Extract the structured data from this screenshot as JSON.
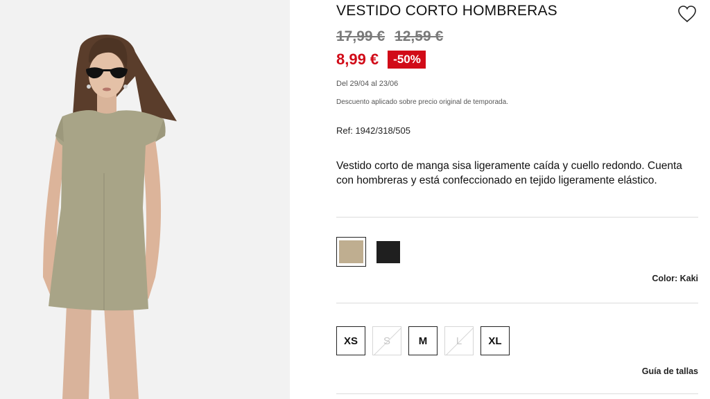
{
  "product": {
    "title": "VESTIDO CORTO HOMBRERAS",
    "old_prices": [
      "17,99 €",
      "12,59 €"
    ],
    "price": "8,99 €",
    "discount_badge": "-50%",
    "date_range": "Del 29/04 al 23/06",
    "discount_note": "Descuento aplicado sobre precio original de temporada.",
    "ref": "Ref: 1942/318/505",
    "description": "Vestido corto de manga sisa ligeramente caída y cuello redondo. Cuenta con hombreras y está confeccionado en tejido ligeramente elástico."
  },
  "colors": {
    "swatches": [
      {
        "name": "kaki",
        "hex": "#bfae90",
        "selected": true
      },
      {
        "name": "black",
        "hex": "#1f1f1f",
        "selected": false
      }
    ],
    "label": "Color: Kaki"
  },
  "sizes": {
    "options": [
      {
        "label": "XS",
        "available": true
      },
      {
        "label": "S",
        "available": false
      },
      {
        "label": "M",
        "available": true
      },
      {
        "label": "L",
        "available": false
      },
      {
        "label": "XL",
        "available": true
      }
    ],
    "guide_label": "Guía de tallas"
  },
  "icons": {
    "wishlist": "heart-icon"
  },
  "theme": {
    "sale_red": "#d10b18",
    "dress_color": "#a8a487"
  }
}
